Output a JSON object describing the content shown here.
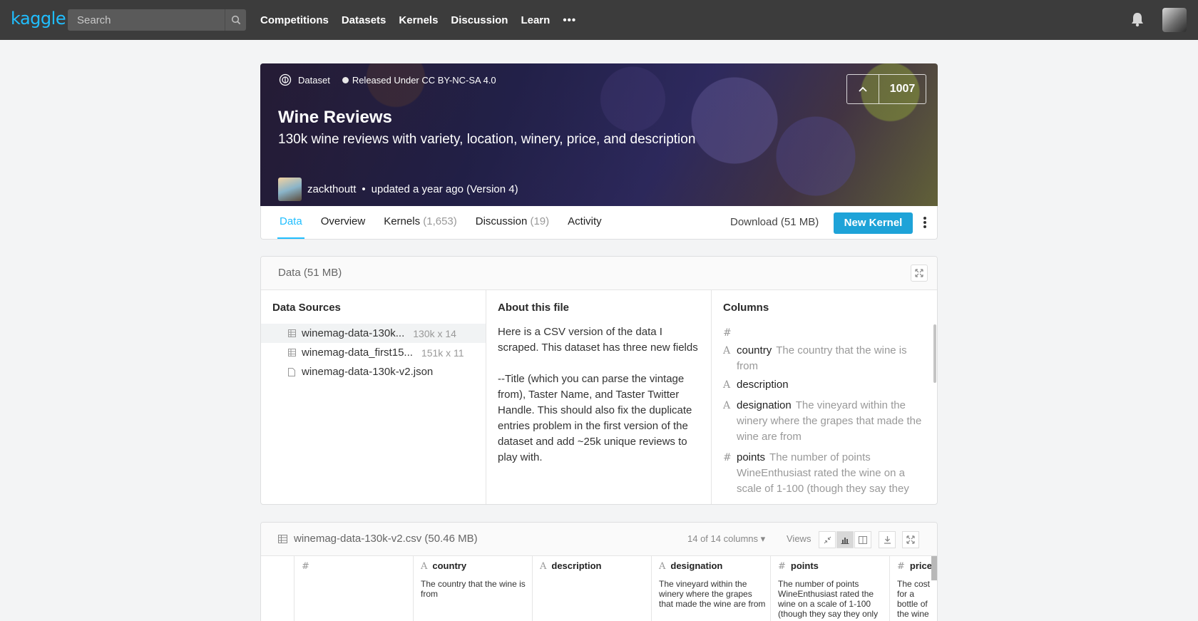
{
  "nav": {
    "logo": "kaggle",
    "search_placeholder": "Search",
    "links": [
      "Competitions",
      "Datasets",
      "Kernels",
      "Discussion",
      "Learn"
    ],
    "more": "•••"
  },
  "hero": {
    "type_label": "Dataset",
    "license": "Released Under CC BY-NC-SA 4.0",
    "title": "Wine Reviews",
    "subtitle": "130k wine reviews with variety, location, winery, price, and description",
    "author": "zackthoutt",
    "updated": "updated a year ago (Version 4)",
    "votes": "1007"
  },
  "tabs": {
    "items": [
      {
        "label": "Data",
        "count": ""
      },
      {
        "label": "Overview",
        "count": ""
      },
      {
        "label": "Kernels",
        "count": "(1,653)"
      },
      {
        "label": "Discussion",
        "count": "(19)"
      },
      {
        "label": "Activity",
        "count": ""
      }
    ],
    "download": "Download (51 MB)",
    "new_kernel": "New Kernel"
  },
  "data_panel": {
    "header": "Data (51 MB)",
    "sources_title": "Data Sources",
    "sources": [
      {
        "name": "winemag-data-130k...",
        "dims": "130k x 14"
      },
      {
        "name": "winemag-data_first15...",
        "dims": "151k x 11"
      },
      {
        "name": "winemag-data-130k-v2.json",
        "dims": ""
      }
    ],
    "about_title": "About this file",
    "about_p1": "Here is a CSV version of the data I scraped. This dataset has three new fields",
    "about_p2": "--Title (which you can parse the vintage from), Taster Name, and Taster Twitter Handle. This should also fix the duplicate entries problem in the first version of the dataset and add ~25k unique reviews to play with.",
    "columns_title": "Columns",
    "columns": [
      {
        "type": "#",
        "name": "",
        "desc": ""
      },
      {
        "type": "A",
        "name": "country",
        "desc": "The country that the wine is from"
      },
      {
        "type": "A",
        "name": "description",
        "desc": ""
      },
      {
        "type": "A",
        "name": "designation",
        "desc": "The vineyard within the winery where the grapes that made the wine are from"
      },
      {
        "type": "#",
        "name": "points",
        "desc": "The number of points WineEnthusiast rated the wine on a scale of 1-100 (though they say they"
      }
    ]
  },
  "file_panel": {
    "filename": "winemag-data-130k-v2.csv (50.46 MB)",
    "columns_shown": "14 of 14 columns",
    "views_label": "Views",
    "grid": [
      {
        "type": "#",
        "name": "",
        "desc": ""
      },
      {
        "type": "A",
        "name": "country",
        "desc": "The country that the wine is from"
      },
      {
        "type": "A",
        "name": "description",
        "desc": ""
      },
      {
        "type": "A",
        "name": "designation",
        "desc": "The vineyard within the winery where the grapes that made the wine are from"
      },
      {
        "type": "#",
        "name": "points",
        "desc": "The number of points WineEnthusiast rated the wine on a scale of 1-100 (though they say they only"
      },
      {
        "type": "#",
        "name": "price",
        "desc": "The cost for a bottle of the wine"
      }
    ]
  },
  "colors": {
    "topnav": "#3c3c3c",
    "accent": "#20beff",
    "button": "#1ea3d8"
  }
}
